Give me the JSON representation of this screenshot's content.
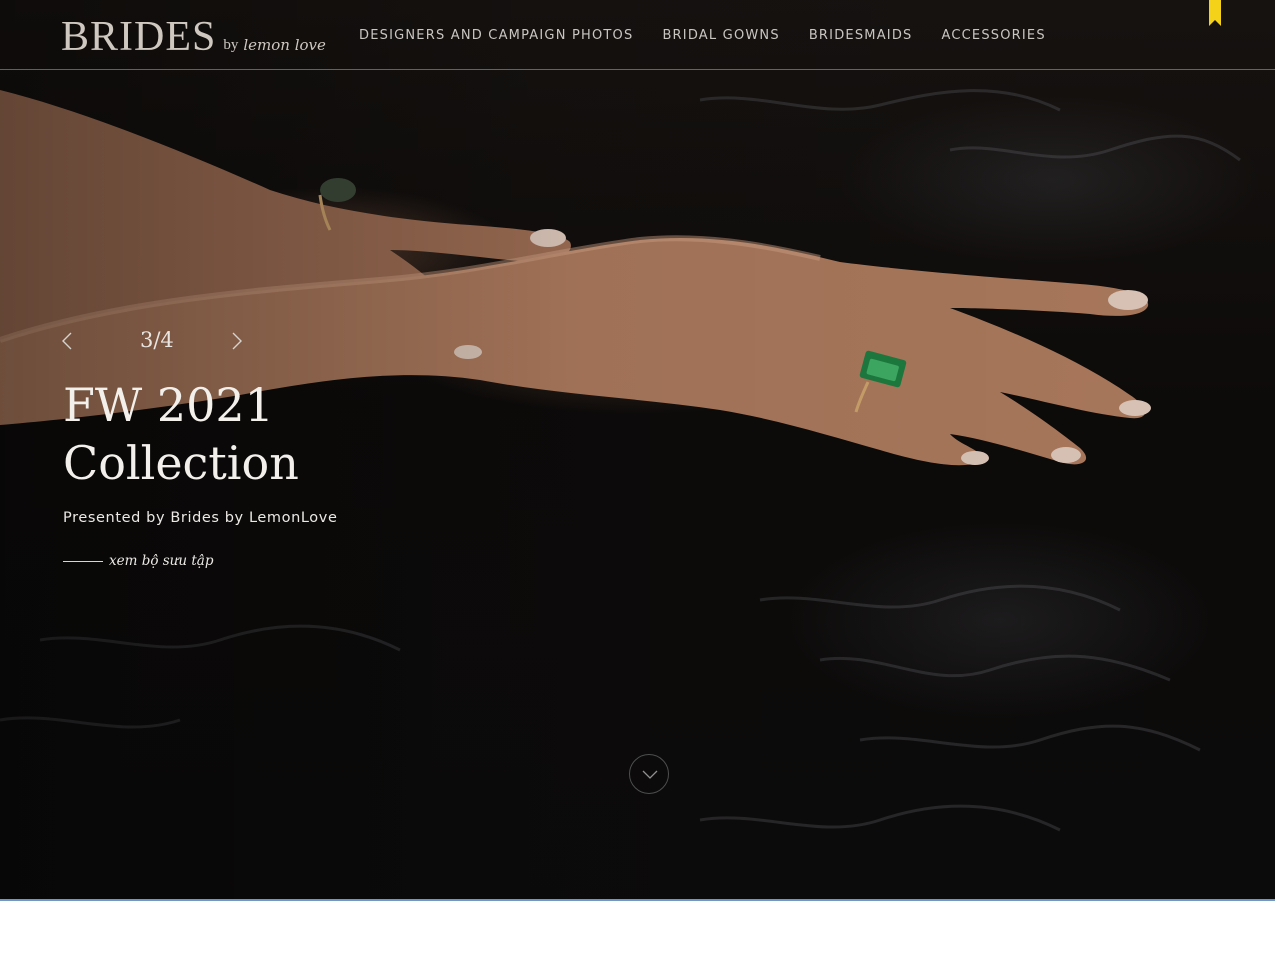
{
  "header": {
    "logo_main": "BRIDES",
    "logo_by": "by",
    "logo_script": "lemon love",
    "nav": [
      {
        "label": "DESIGNERS AND CAMPAIGN PHOTOS"
      },
      {
        "label": "BRIDAL GOWNS"
      },
      {
        "label": "BRIDESMAIDS"
      },
      {
        "label": "ACCESSORIES"
      }
    ],
    "bookmark_color": "#f4d21a"
  },
  "hero": {
    "counter": "3/4",
    "title": "FW 2021 Collection",
    "subtitle": "Presented by Brides by LemonLove",
    "view_link": "xem bộ sưu tập",
    "image_alt": "hands with emerald ring resting on dark water"
  },
  "colors": {
    "accent_line": "#6f98c6",
    "hero_bg": "#0d0b0a"
  },
  "icons": {
    "prev": "chevron-left-icon",
    "next": "chevron-right-icon",
    "scroll": "chevron-down-icon",
    "bookmark": "bookmark-icon"
  }
}
